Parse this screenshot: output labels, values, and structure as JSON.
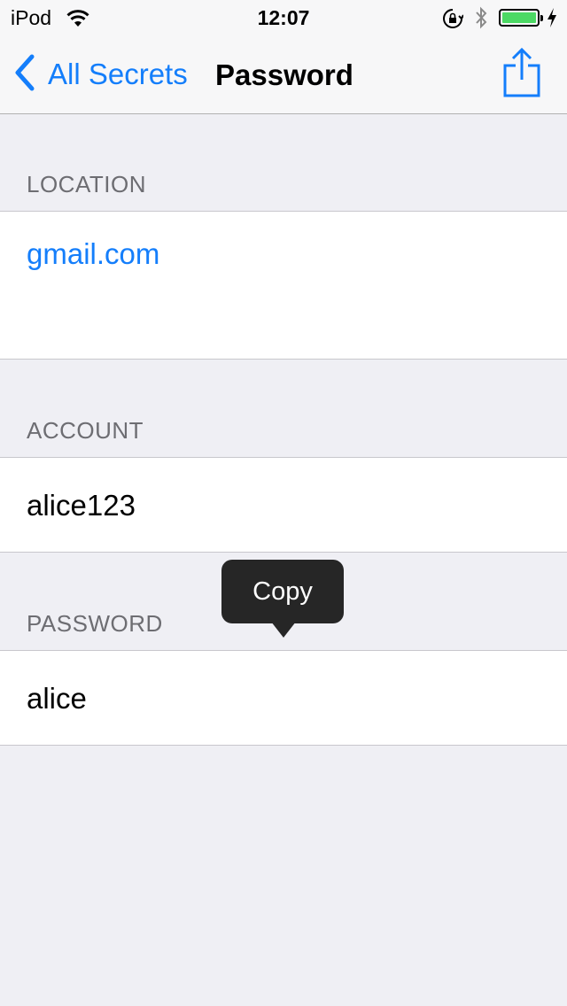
{
  "status_bar": {
    "carrier": "iPod",
    "time": "12:07",
    "icons": [
      "wifi-icon",
      "rotation-lock-icon",
      "bluetooth-icon",
      "battery-icon",
      "charging-icon"
    ],
    "battery_color": "#4cd964"
  },
  "nav": {
    "back_label": "All Secrets",
    "title": "Password",
    "accent_color": "#147efb",
    "share_icon": "share-icon"
  },
  "sections": {
    "location": {
      "header": "LOCATION",
      "value": "gmail.com"
    },
    "account": {
      "header": "ACCOUNT",
      "value": "alice123"
    },
    "password": {
      "header": "PASSWORD",
      "value": "alice"
    }
  },
  "popup": {
    "copy_label": "Copy"
  }
}
